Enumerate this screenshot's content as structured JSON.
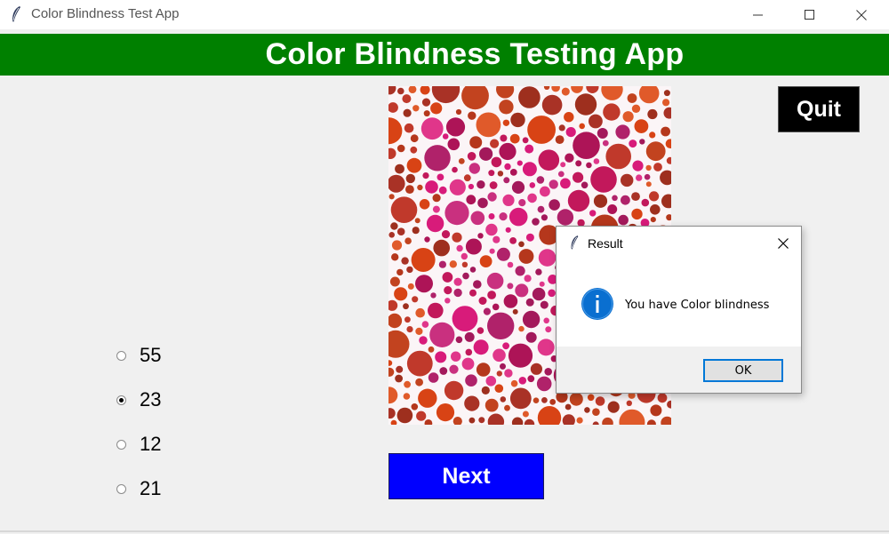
{
  "window": {
    "title": "Color Blindness Test App",
    "icon": "feather-icon"
  },
  "header": {
    "title": "Color Blindness Testing App",
    "background": "#008000"
  },
  "quit_button": {
    "label": "Quit",
    "background": "#000000"
  },
  "plate": {
    "description_icon": "ishihara-plate-image"
  },
  "options": [
    {
      "label": "55",
      "selected": false
    },
    {
      "label": "23",
      "selected": true
    },
    {
      "label": "12",
      "selected": false
    },
    {
      "label": "21",
      "selected": false
    }
  ],
  "next_button": {
    "label": "Next",
    "background": "#0000ff"
  },
  "dialog": {
    "title": "Result",
    "message": "You have Color blindness",
    "icon": "info-icon",
    "ok_label": "OK",
    "accent": "#0078d7"
  }
}
